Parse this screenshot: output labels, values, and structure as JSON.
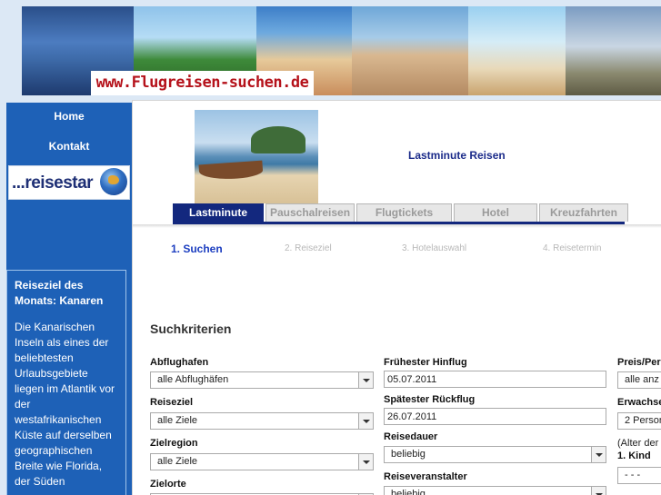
{
  "header": {
    "site_title": "www.Flugreisen-suchen.de"
  },
  "sidebar": {
    "nav": [
      {
        "label": "Home"
      },
      {
        "label": "Kontakt"
      }
    ],
    "logo_text": "...reisestar",
    "promo": {
      "title": "Reiseziel des Monats: Kanaren",
      "body": "Die Kanarischen Inseln als eines der beliebtesten Urlaubsgebiete liegen im Atlantik vor der westafrikanischen Küste auf derselben geographischen Breite wie Florida, der Süden"
    }
  },
  "main": {
    "hero_title": "Lastminute Reisen",
    "tabs": [
      {
        "label": "Lastminute",
        "active": true
      },
      {
        "label": "Pauschalreisen",
        "active": false
      },
      {
        "label": "Flugtickets",
        "active": false
      },
      {
        "label": "Hotel",
        "active": false
      },
      {
        "label": "Kreuzfahrten",
        "active": false
      }
    ],
    "steps": [
      {
        "label": "1. Suchen",
        "active": true
      },
      {
        "label": "2. Reiseziel",
        "active": false
      },
      {
        "label": "3. Hotelauswahl",
        "active": false
      },
      {
        "label": "4. Reisetermin",
        "active": false
      }
    ],
    "criteria_title": "Suchkriterien",
    "form": {
      "abflughafen": {
        "label": "Abflughafen",
        "value": "alle Abflughäfen"
      },
      "reiseziel": {
        "label": "Reiseziel",
        "value": "alle Ziele"
      },
      "zielregion": {
        "label": "Zielregion",
        "value": "alle Ziele"
      },
      "zielorte": {
        "label": "Zielorte",
        "value": ""
      },
      "hinflug": {
        "label": "Frühester Hinflug",
        "value": "05.07.2011"
      },
      "rueckflug": {
        "label": "Spätester Rückflug",
        "value": "26.07.2011"
      },
      "reisedauer": {
        "label": "Reisedauer",
        "value": "beliebig"
      },
      "veranstalter": {
        "label": "Reiseveranstalter",
        "value": "beliebig"
      },
      "preis": {
        "label": "Preis/Per",
        "value": "alle anz"
      },
      "erwachsene": {
        "label": "Erwachse",
        "value": "2 Person"
      },
      "alter_note": "(Alter der",
      "kind1": {
        "label": "1. Kind",
        "value": "- - -"
      }
    }
  },
  "colors": {
    "sidebar_bg": "#1e61b7",
    "tab_active": "#13287e",
    "step_active": "#1c3ec0",
    "site_title": "#b5121b"
  }
}
